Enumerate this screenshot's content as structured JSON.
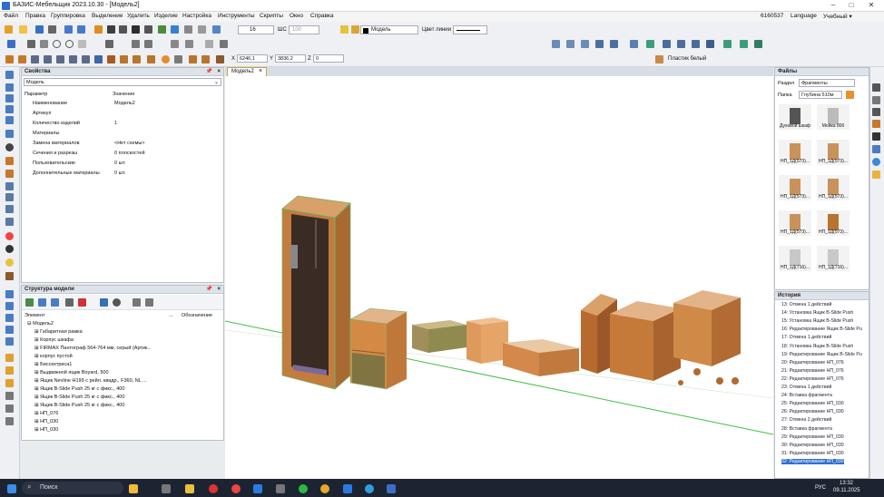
{
  "window": {
    "title": "БАЗИС-Мебельщик 2023.10.30 - [Модель2]",
    "minimize": "–",
    "maximize": "□",
    "close": "✕"
  },
  "menu": [
    "Файл",
    "Правка",
    "Группировка",
    "Выделение",
    "Удалить",
    "Изделие",
    "Настройка",
    "Инструменты",
    "Скрипты",
    "Окно",
    "Справка"
  ],
  "menu_right": {
    "id": "6160537",
    "language": "Language",
    "mode": "Учебный ▾"
  },
  "toolbar": {
    "line_width": "16",
    "shc_label": "ШС",
    "shc_value": "100",
    "layer_label": "Модель",
    "line_color_label": "Цвет линии",
    "x_label": "X",
    "x_value": "6246,1",
    "y_label": "Y",
    "y_value": "3836,2",
    "z_label": "Z",
    "z_value": "0",
    "material": "Пластик белый"
  },
  "properties": {
    "title": "Свойства",
    "selector": "Модель",
    "col_param": "Параметр",
    "col_value": "Значение",
    "rows": [
      {
        "k": "Наименование",
        "v": "Модель2"
      },
      {
        "k": "Артикул",
        "v": ""
      },
      {
        "k": "Количество изделий",
        "v": "1"
      },
      {
        "k": "Материалы",
        "v": ""
      },
      {
        "k": "Замена материалов",
        "v": "<Нет схемы>"
      },
      {
        "k": "Сечения и разрезы",
        "v": "0 плоскостей"
      },
      {
        "k": "Пользовательские",
        "v": "0 шт."
      },
      {
        "k": "Дополнительные материалы",
        "v": "0 шт."
      }
    ]
  },
  "structure": {
    "title": "Структура модели",
    "col_element": "Элемент",
    "col_dots": "...",
    "col_designation": "Обозначение",
    "root": "Модель2",
    "items": [
      "Габаритная рамка",
      "Корпус шкафа",
      "FIRMAX Пантограф 564-764 мм, серый (Артик...",
      "корпус пустой",
      "Биссектриса1",
      "Выдвижной ящик Boyard, 500",
      "Ящик Nevline H199 с рейл. квадр., F360, NL ...",
      "Ящик B-Slide Push 25 кг с фикс., 400",
      "Ящик B-Slide Push 25 кг с фикс., 400",
      "Ящик B-Slide Push 25 кг с фикс., 400",
      "НП_076",
      "НП_030",
      "НП_030"
    ]
  },
  "doc_tab": {
    "label": "Модель2",
    "close": "×"
  },
  "files": {
    "title": "Файлы",
    "section_label": "Раздел",
    "section_value": "Фрагменты",
    "folder_label": "Папка",
    "folder_value": "Глубина 510м",
    "items": [
      "Духовой шкаф",
      "Мойка 800",
      "НП_1Д(573)...",
      "НП_1Д(573)...",
      "НП_1Д(573)...",
      "НП_1Д(573)...",
      "НП_1Д(573)...",
      "НП_1Д(573)...",
      "НП_1Д(716)...",
      "НП_1Д(716)..."
    ]
  },
  "history": {
    "title": "История",
    "items": [
      {
        "n": "13:",
        "t": "Отмена 1 действий"
      },
      {
        "n": "14:",
        "t": "Установка Ящик B-Slide Push"
      },
      {
        "n": "15:",
        "t": "Установка Ящик B-Slide Push"
      },
      {
        "n": "16:",
        "t": "Редактирование Ящик B-Slide Pu"
      },
      {
        "n": "17:",
        "t": "Отмена 1 действий"
      },
      {
        "n": "18:",
        "t": "Установка Ящик B-Slide Push"
      },
      {
        "n": "19:",
        "t": "Редактирование Ящик B-Slide Pu"
      },
      {
        "n": "20:",
        "t": "Редактирование НП_076"
      },
      {
        "n": "21:",
        "t": "Редактирование НП_076"
      },
      {
        "n": "22:",
        "t": "Редактирование НП_076"
      },
      {
        "n": "23:",
        "t": "Отмена 1 действий"
      },
      {
        "n": "24:",
        "t": "Вставка фрагмента"
      },
      {
        "n": "25:",
        "t": "Редактирование НП_030"
      },
      {
        "n": "26:",
        "t": "Редактирование НП_030"
      },
      {
        "n": "27:",
        "t": "Отмена 2 действий"
      },
      {
        "n": "28:",
        "t": "Вставка фрагмента"
      },
      {
        "n": "29:",
        "t": "Редактирование НП_030"
      },
      {
        "n": "30:",
        "t": "Редактирование НП_030"
      },
      {
        "n": "31:",
        "t": "Редактирование НП_030"
      },
      {
        "n": "32:",
        "t": "Редактирование НП_030"
      }
    ]
  },
  "taskbar": {
    "search": "Поиск",
    "time": "13:32",
    "date": "09.11.2025",
    "lang": "РУС"
  }
}
